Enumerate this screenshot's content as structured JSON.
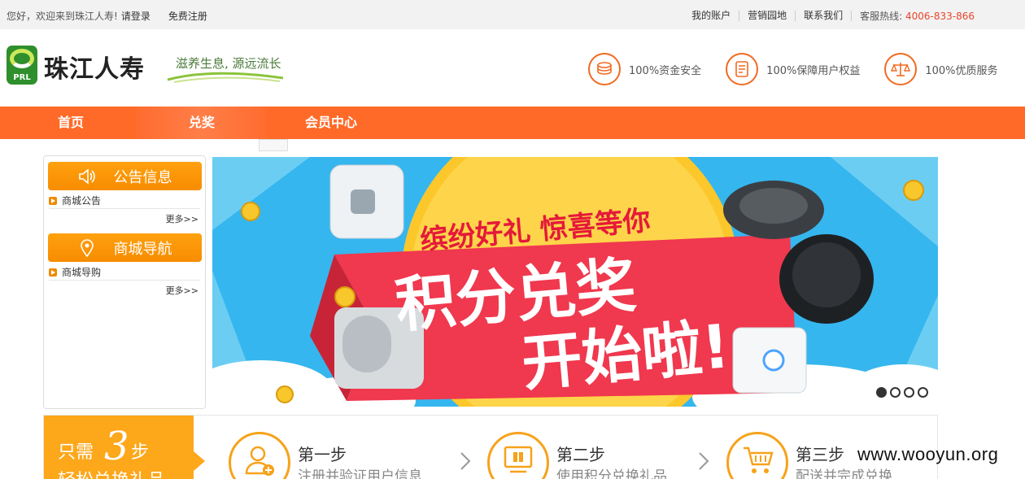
{
  "topbar": {
    "greeting": "您好，欢迎来到珠江人寿!",
    "login": "请登录",
    "register": "免费注册",
    "links": [
      "我的账户",
      "营销园地",
      "联系我们"
    ],
    "hotline_label": "客服热线:",
    "hotline_number": "4006-833-866"
  },
  "header": {
    "logo_letters": "PRL",
    "brand": "珠江人寿",
    "slogan": "滋养生息, 源远流长",
    "guarantees": [
      {
        "icon": "coins-icon",
        "text": "100%资金安全"
      },
      {
        "icon": "document-icon",
        "text": "100%保障用户权益"
      },
      {
        "icon": "scale-icon",
        "text": "100%优质服务"
      }
    ]
  },
  "nav": {
    "items": [
      "首页",
      "兑奖",
      "会员中心"
    ],
    "active": "兑奖"
  },
  "sidebar": {
    "sections": [
      {
        "title": "公告信息",
        "icon": "speaker-icon",
        "items": [
          "商城公告"
        ],
        "more": "更多>>"
      },
      {
        "title": "商城导航",
        "icon": "location-pin-icon",
        "items": [
          "商城导购"
        ],
        "more": "更多>>"
      }
    ]
  },
  "banner": {
    "line1": "缤纷好礼 惊喜等你",
    "line2": "积分兑奖",
    "line3": "开始啦!",
    "slides": 4,
    "active_slide": 1
  },
  "steps": {
    "badge_prefix": "只需",
    "badge_number": "3",
    "badge_suffix": "步",
    "badge_line2": "轻松兑换礼品",
    "items": [
      {
        "title": "第一步",
        "desc": "注册并验证用户信息",
        "icon": "user-add-icon"
      },
      {
        "title": "第二步",
        "desc": "使用积分兑换礼品",
        "icon": "gift-screen-icon"
      },
      {
        "title": "第三步",
        "desc": "配送并完成兑换",
        "icon": "cart-icon"
      }
    ]
  },
  "watermark": "www.wooyun.org",
  "colors": {
    "nav": "#ff6a28",
    "accent": "#f7a21b",
    "hotline": "#e8462b",
    "banner_sky": "#5cc4f0",
    "banner_ribbon": "#f0384e"
  }
}
